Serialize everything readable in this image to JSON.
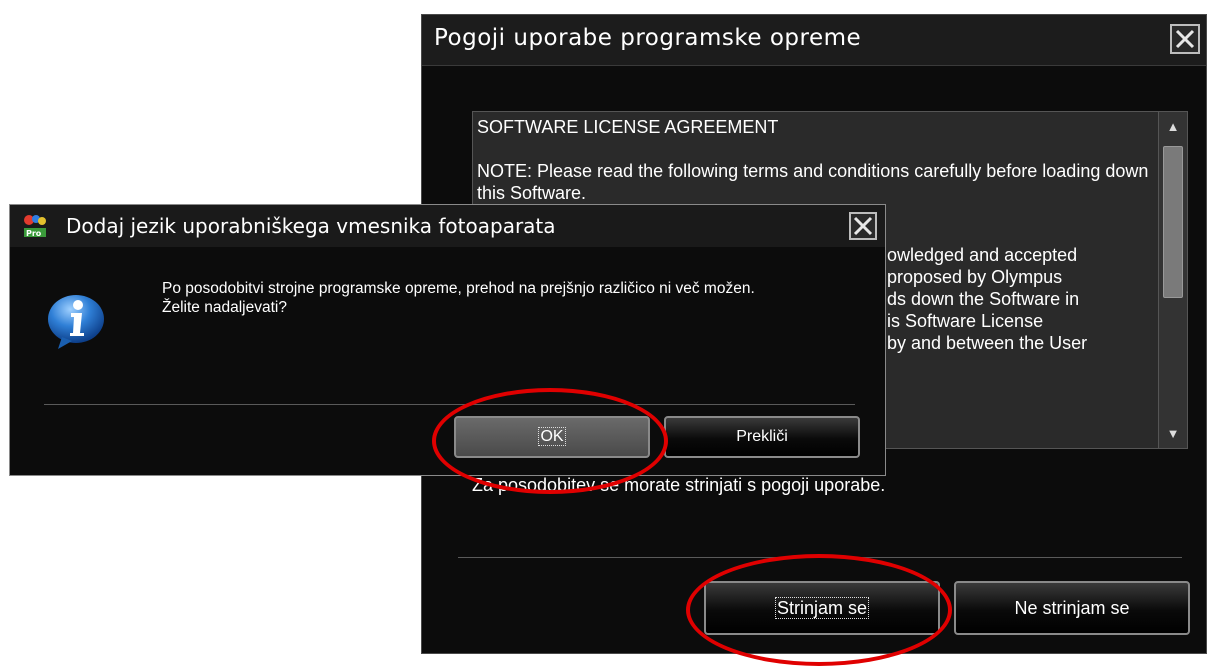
{
  "license_window": {
    "title": "Pogoji uporabe programske opreme",
    "license_heading": "SOFTWARE LICENSE AGREEMENT",
    "license_paragraph": "NOTE: Please read the following terms and conditions carefully before loading down this Software.",
    "license_fragment_lines": [
      "owledged and accepted",
      "proposed by Olympus",
      "ds down the Software in",
      "is Software License",
      "by and between the User"
    ],
    "notice": "Za posodobitev se morate strinjati s pogoji uporabe.",
    "agree_label": "Strinjam se",
    "disagree_label": "Ne strinjam se"
  },
  "dialog": {
    "title": "Dodaj jezik uporabniškega vmesnika fotoaparata",
    "message_line1": "Po posodobitvi strojne programske opreme, prehod na prejšnjo različico ni več možen.",
    "message_line2": "Želite nadaljevati?",
    "ok_label": "OK",
    "cancel_label": "Prekliči"
  },
  "icons": {
    "close": "close-icon",
    "info": "info-icon",
    "app": "olympus-pro-app-icon",
    "scroll_up": "▲",
    "scroll_down": "▼"
  },
  "colors": {
    "window_bg": "#0c0c0c",
    "highlight_ring": "#e00000"
  }
}
